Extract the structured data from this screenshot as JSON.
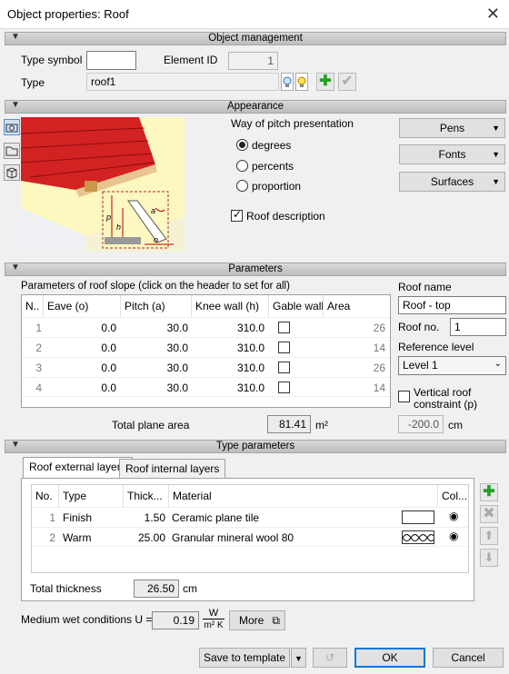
{
  "window": {
    "title": "Object properties: Roof",
    "close": "✕"
  },
  "sections": {
    "object_management": "Object management",
    "appearance": "Appearance",
    "parameters": "Parameters",
    "type_parameters": "Type parameters"
  },
  "object_management": {
    "type_symbol_label": "Type symbol",
    "type_symbol_value": "",
    "element_id_label": "Element ID",
    "element_id_value": "1",
    "type_label": "Type",
    "type_value": "roof1"
  },
  "appearance": {
    "pitch_title": "Way of pitch presentation",
    "options": [
      "degrees",
      "percents",
      "proportion"
    ],
    "selected": "degrees",
    "roof_description_label": "Roof description",
    "roof_description_checked": true,
    "buttons": [
      "Pens",
      "Fonts",
      "Surfaces"
    ],
    "diagram_labels": {
      "p": "p",
      "h": "h",
      "a": "a",
      "o": "o"
    }
  },
  "parameters": {
    "slope_title": "Parameters of roof slope (click on the header to set for all)",
    "columns": [
      "N..",
      "Eave (o)",
      "Pitch (a)",
      "Knee wall (h)",
      "Gable wall",
      "Area"
    ],
    "rows": [
      {
        "n": "1",
        "eave": "0.0",
        "pitch": "30.0",
        "knee": "310.0",
        "area": "26"
      },
      {
        "n": "2",
        "eave": "0.0",
        "pitch": "30.0",
        "knee": "310.0",
        "area": "14"
      },
      {
        "n": "3",
        "eave": "0.0",
        "pitch": "30.0",
        "knee": "310.0",
        "area": "26"
      },
      {
        "n": "4",
        "eave": "0.0",
        "pitch": "30.0",
        "knee": "310.0",
        "area": "14"
      }
    ],
    "roof_name_label": "Roof name",
    "roof_name_value": "Roof - top",
    "roof_no_label": "Roof no.",
    "roof_no_value": "1",
    "ref_level_label": "Reference level",
    "ref_level_value": "Level 1",
    "vertical_constraint_label_1": "Vertical roof",
    "vertical_constraint_label_2": "constraint (p)",
    "total_area_label": "Total plane area",
    "total_area_value": "81.41",
    "total_area_unit": "m²",
    "constraint_value": "-200.0",
    "constraint_unit": "cm"
  },
  "type_parameters": {
    "tabs": [
      "Roof external layers",
      "Roof internal layers"
    ],
    "columns": [
      "No.",
      "Type",
      "Thick...",
      "Material",
      "Col..."
    ],
    "layers": [
      {
        "no": "1",
        "type": "Finish",
        "thick": "1.50",
        "material": "Ceramic plane tile"
      },
      {
        "no": "2",
        "type": "Warm",
        "thick": "25.00",
        "material": "Granular mineral wool 80"
      }
    ],
    "total_thickness_label": "Total thickness",
    "total_thickness_value": "26.50",
    "total_thickness_unit": "cm",
    "u_label": "Medium wet conditions U =",
    "u_value": "0.19",
    "u_unit_num": "W",
    "u_unit_den": "m² K",
    "more_label": "More"
  },
  "footer": {
    "save_template": "Save to template",
    "ok": "OK",
    "cancel": "Cancel"
  }
}
